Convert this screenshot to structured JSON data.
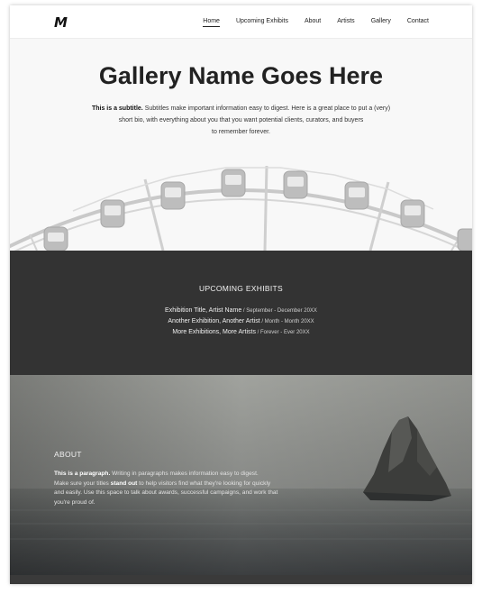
{
  "nav": {
    "logo": "M",
    "links": [
      {
        "label": "Home",
        "active": true
      },
      {
        "label": "Upcoming Exhibits",
        "active": false
      },
      {
        "label": "About",
        "active": false
      },
      {
        "label": "Artists",
        "active": false
      },
      {
        "label": "Gallery",
        "active": false
      },
      {
        "label": "Contact",
        "active": false
      }
    ]
  },
  "hero": {
    "title": "Gallery Name Goes Here",
    "subtitle_lead": "This is a subtitle.",
    "subtitle_line1": " Subtitles make important information easy to digest. Here is a great place to put a (very)",
    "subtitle_line2": "short bio, with everything about you that you want potential clients, curators, and buyers",
    "subtitle_line3": "to remember forever."
  },
  "upcoming": {
    "heading": "UPCOMING EXHIBITS",
    "items": [
      {
        "title": "Exhibition Title, Artist Name",
        "date": " / September - December 20XX"
      },
      {
        "title": "Another Exhibition, Another Artist",
        "date": " / Month - Month 20XX"
      },
      {
        "title": "More Exhibitions, More Artists",
        "date": " / Forever - Ever 20XX"
      }
    ]
  },
  "about": {
    "heading": "ABOUT",
    "p_lead": "This is a paragraph.",
    "p_1": " Writing in paragraphs makes information easy to digest.",
    "p_2a": "Make sure your titles ",
    "p_2b": "stand out",
    "p_2c": " to help visitors find what they're looking for quickly",
    "p_3": "and easily. Use this space to talk about awards, successful campaigns, and work that",
    "p_4": "you're proud of."
  },
  "colors": {
    "dark_band": "#333333",
    "hero_bg": "#f8f8f8"
  }
}
